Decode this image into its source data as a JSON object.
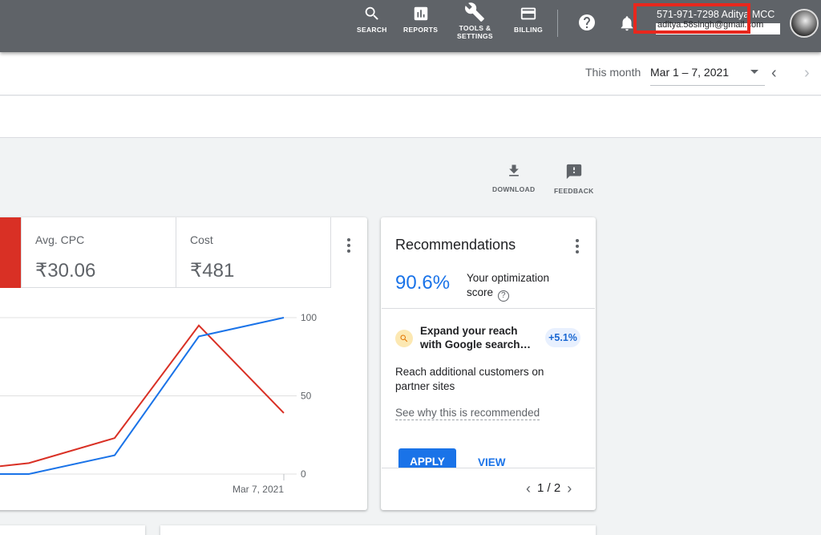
{
  "topbar": {
    "search_label": "SEARCH",
    "reports_label": "REPORTS",
    "tools_label_line1": "TOOLS &",
    "tools_label_line2": "SETTINGS",
    "billing_label": "BILLING",
    "account_line1": "571-971-7298 Aditya MCC",
    "account_line2": "aditya.58singh@gmail.com"
  },
  "date_range": {
    "label": "This month",
    "value": "Mar 1 – 7, 2021"
  },
  "actions": {
    "download_label": "DOWNLOAD",
    "feedback_label": "FEEDBACK"
  },
  "metrics": [
    {
      "label": "Avg. CPC",
      "value": "₹30.06"
    },
    {
      "label": "Cost",
      "value": "₹481"
    }
  ],
  "chart_data": {
    "type": "line",
    "x": [
      "",
      "",
      "",
      "",
      "Mar 7, 2021"
    ],
    "xlabel": "",
    "ylabel": "",
    "ylim": [
      0,
      100
    ],
    "y_ticks": [
      "100",
      "50",
      "0"
    ],
    "x_tick_label": "Mar 7, 2021",
    "series": [
      {
        "color": "#d93025",
        "values": [
          5,
          7,
          23,
          95,
          39
        ]
      },
      {
        "color": "#1a73e8",
        "values": [
          0,
          0,
          12,
          88,
          100
        ]
      }
    ]
  },
  "recommendations": {
    "title": "Recommendations",
    "score": "90.6%",
    "score_label": "Your optimization score",
    "card_title": "Expand your reach with Google search…",
    "badge": "+5.1%",
    "description": "Reach additional customers on partner sites",
    "why_link": "See why this is recommended",
    "apply_label": "APPLY",
    "view_label": "VIEW",
    "pager": "1 / 2"
  }
}
